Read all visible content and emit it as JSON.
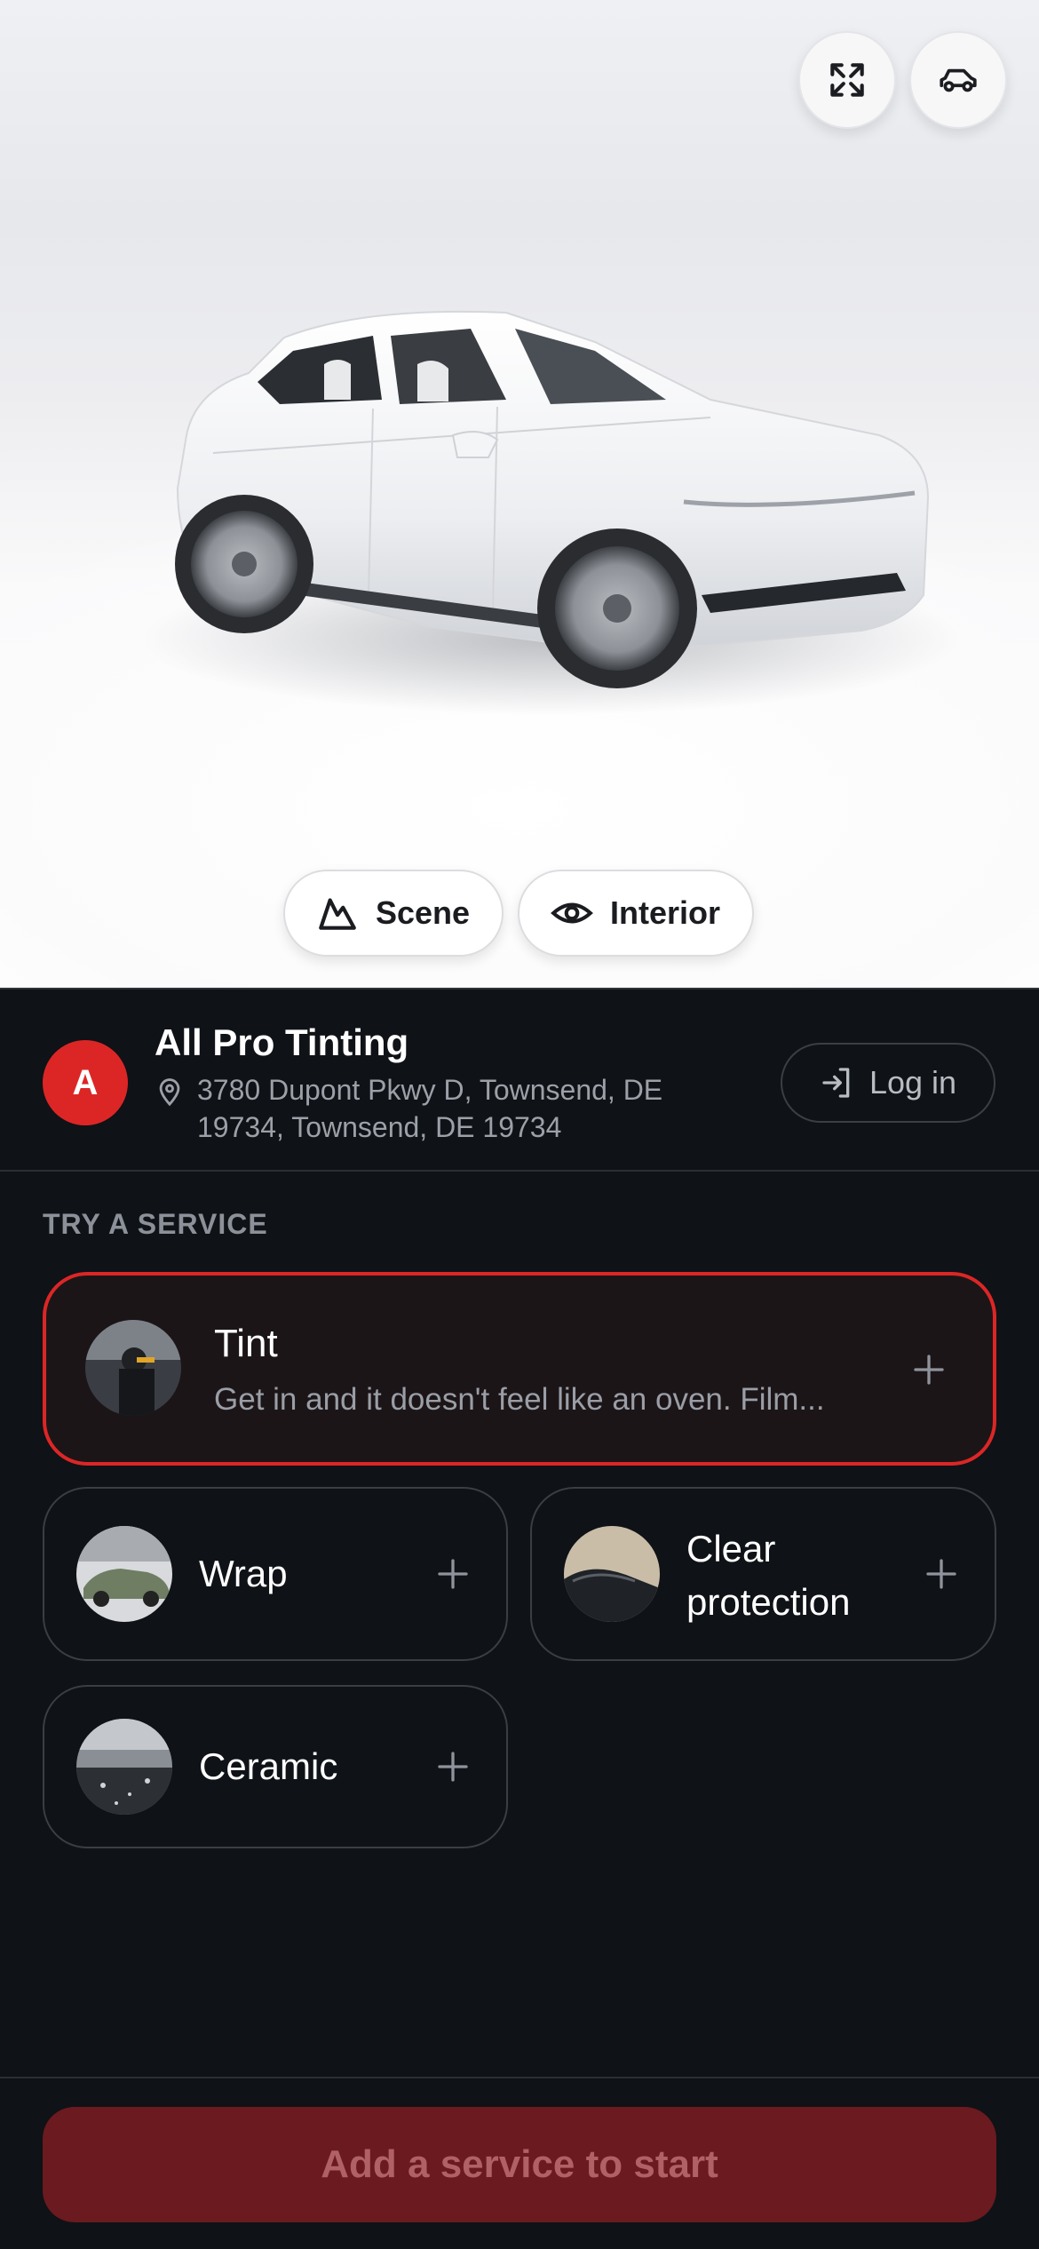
{
  "viewer": {
    "fullscreen_icon": "expand-icon",
    "vehicle_icon": "car-icon",
    "scene_label": "Scene",
    "scene_icon": "mountain-icon",
    "interior_label": "Interior",
    "interior_icon": "eye-icon",
    "car_color": "#f4f5f7"
  },
  "shop": {
    "avatar_letter": "A",
    "avatar_color": "#dc2626",
    "name": "All Pro Tinting",
    "address": "3780 Dupont Pkwy D, Townsend, DE 19734, Townsend, DE 19734",
    "address_icon": "location-pin-icon",
    "login_label": "Log in",
    "login_icon": "login-arrow-icon"
  },
  "services": {
    "section_title": "TRY A SERVICE",
    "items": [
      {
        "title": "Tint",
        "description": "Get in and it doesn't feel like an oven. Film...",
        "selected": true
      },
      {
        "title": "Wrap"
      },
      {
        "title_line1": "Clear",
        "title_line2": "protection"
      },
      {
        "title": "Ceramic"
      }
    ],
    "add_icon": "plus-icon",
    "accent": "#dc2626"
  },
  "footer": {
    "cta_label": "Add a service to start",
    "cta_color": "#6b1a1f"
  }
}
